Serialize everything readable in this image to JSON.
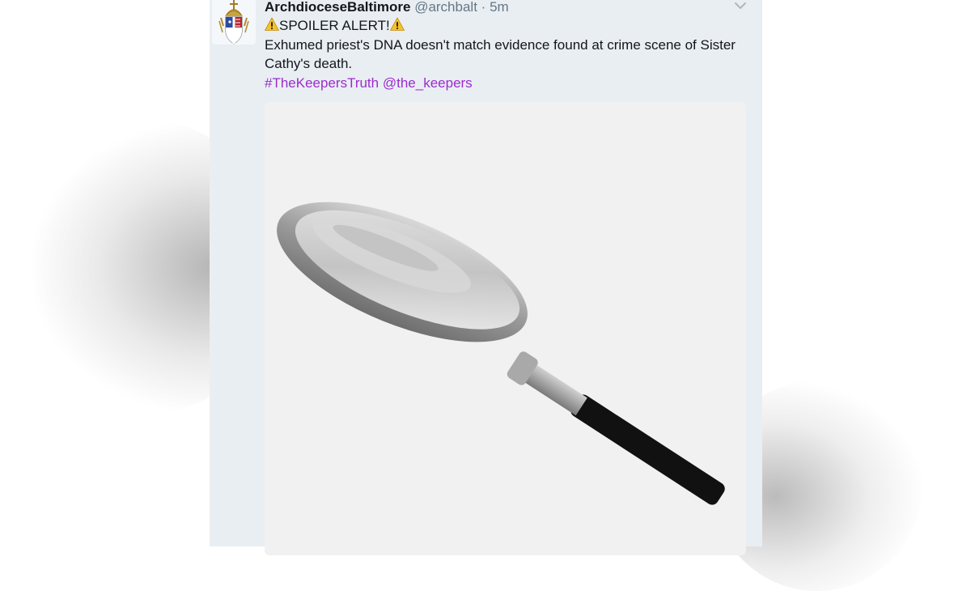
{
  "tweet": {
    "display_name": "ArchdioceseBaltimore",
    "handle": "@archbalt",
    "separator": "·",
    "time": "5m",
    "spoiler_label": "SPOILER ALERT!",
    "line2": "Exhumed priest's DNA doesn't match evidence found at crime scene of Sister Cathy's death.",
    "hashtag": "#TheKeepersTruth",
    "mention": "@the_keepers",
    "avatar_icon": "archdiocese-coat-of-arms",
    "warning_icon": "warning-sign-emoji",
    "media_icon": "magnifying-glass"
  },
  "colors": {
    "link": "#9b2ccf",
    "name": "#14171a",
    "meta": "#657786",
    "background": "#e9eef2"
  }
}
